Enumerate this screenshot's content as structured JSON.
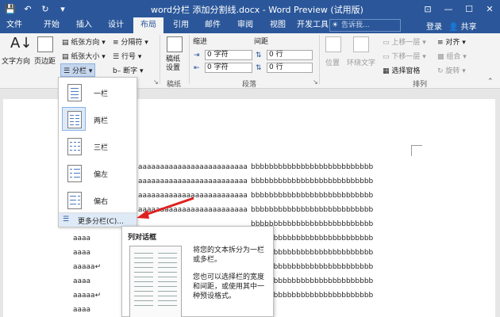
{
  "window": {
    "title": "word分栏 添加分割线.docx - Word Preview (试用版)",
    "controls": [
      "⊡",
      "—",
      "☐",
      "✕"
    ]
  },
  "qat": {
    "icons": [
      "save-icon",
      "undo-icon",
      "redo-icon"
    ]
  },
  "tabs": [
    "文件",
    "开始",
    "插入",
    "设计",
    "布局",
    "引用",
    "邮件",
    "审阅",
    "视图",
    "开发工具"
  ],
  "active_tab": "布局",
  "tellme": "告诉我...",
  "account": {
    "login": "登录",
    "share": "共享"
  },
  "ribbon": {
    "page_setup": {
      "text_direction": "文字方向",
      "margins": "页边距",
      "orientation": "纸张方向",
      "size": "纸张大小",
      "columns": "分栏",
      "breaks": "分隔符",
      "line_numbers": "行号",
      "hyphenation": "断字"
    },
    "draft": {
      "label": "稿纸设置",
      "group": "稿纸"
    },
    "paragraph": {
      "indent": "缩进",
      "spacing": "间距",
      "indent_left": "0 字符",
      "indent_right": "0 字符",
      "space_before": "0 行",
      "space_after": "0 行",
      "group": "段落"
    },
    "arrange": {
      "position": "位置",
      "wrap": "环绕文字",
      "bring_forward": "上移一层",
      "send_backward": "下移一层",
      "selection_pane": "选择窗格",
      "align": "对齐",
      "group_btn": "组合",
      "rotate": "旋转",
      "group": "排列"
    }
  },
  "columns_menu": {
    "items": [
      "一栏",
      "两栏",
      "三栏",
      "偏左",
      "偏右"
    ],
    "more": "更多分栏(C)..."
  },
  "tooltip": {
    "title": "列对话框",
    "p1": "将您的文本拆分为一栏或多栏。",
    "p2": "您也可以选择栏的宽度和间距，或使用其中一种预设格式。"
  },
  "document": {
    "col1_line": "aaaaaaaaaaaaaaaaaaaaaaaaa",
    "col2_line": "bbbbbbbbbbbbbbbbbbbbbbbbbbb",
    "short_line": "aaaa",
    "short_a_line": "aaaaa",
    "end_mark": "↵"
  }
}
